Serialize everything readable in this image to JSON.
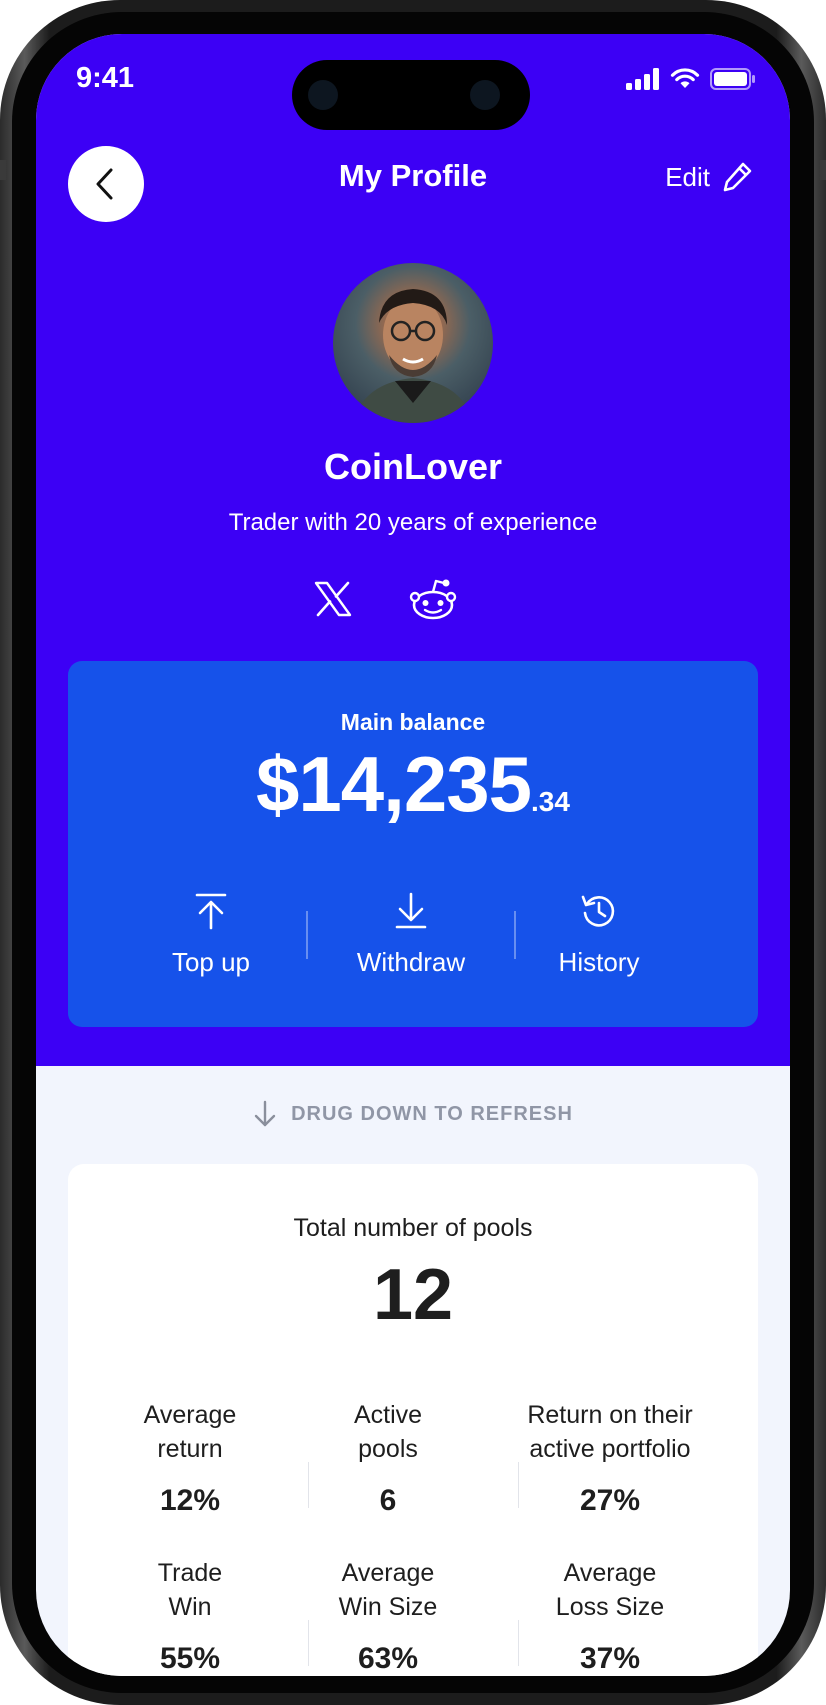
{
  "status_bar": {
    "time": "9:41"
  },
  "header": {
    "title": "My Profile",
    "edit_label": "Edit"
  },
  "profile": {
    "username": "CoinLover",
    "bio": "Trader with 20 years of experience",
    "socials": [
      "x-icon",
      "reddit-icon"
    ]
  },
  "balance": {
    "label": "Main balance",
    "amount_main": "$14,235",
    "amount_cents": ".34",
    "actions": [
      {
        "label": "Top up",
        "icon": "top-up-icon"
      },
      {
        "label": "Withdraw",
        "icon": "withdraw-icon"
      },
      {
        "label": "History",
        "icon": "history-icon"
      }
    ]
  },
  "refresh_hint": "DRUG DOWN TO REFRESH",
  "stats": {
    "total_label": "Total number of pools",
    "total_value": "12",
    "items": [
      {
        "label_line1": "Average",
        "label_line2": "return",
        "value": "12%"
      },
      {
        "label_line1": "Active",
        "label_line2": "pools",
        "value": "6"
      },
      {
        "label_line1": "Return on their",
        "label_line2": "active portfolio",
        "value": "27%"
      },
      {
        "label_line1": "Trade",
        "label_line2": "Win",
        "value": "55%"
      },
      {
        "label_line1": "Average",
        "label_line2": "Win Size",
        "value": "63%"
      },
      {
        "label_line1": "Average",
        "label_line2": "Loss Size",
        "value": "37%"
      }
    ]
  },
  "colors": {
    "hero_bg": "#3c00f5",
    "balance_card": "#1652ea",
    "page_bg": "#f2f5fd"
  }
}
